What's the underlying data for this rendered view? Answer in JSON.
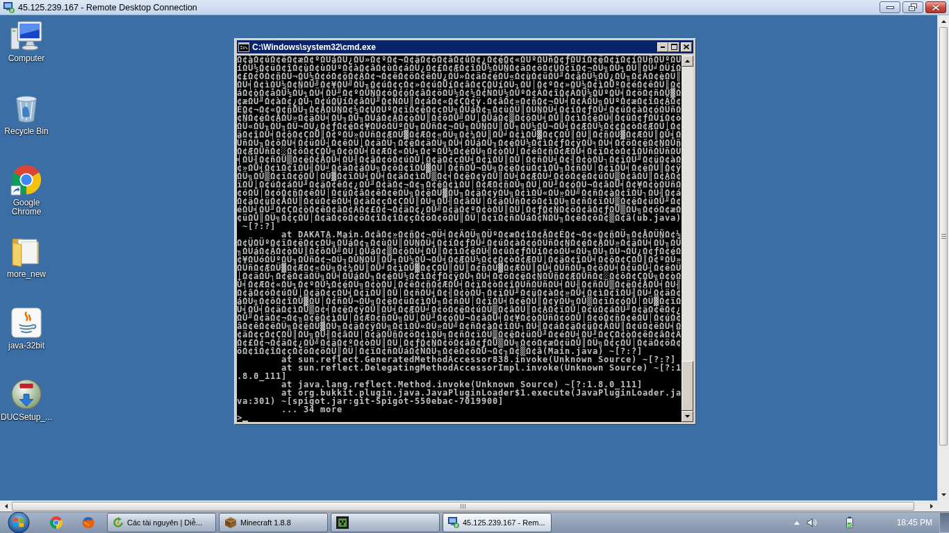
{
  "window": {
    "title": "45.125.239.167 - Remote Desktop Connection"
  },
  "desktop": {
    "icons": [
      {
        "label": "Computer"
      },
      {
        "label": "Recycle Bin"
      },
      {
        "label": "Google Chrome"
      },
      {
        "label": "more_new"
      },
      {
        "label": "java-32bit"
      },
      {
        "label": "DUCSetup_..."
      }
    ]
  },
  "console_window": {
    "title": "C:\\Windows\\system32\\cmd.exe",
    "lines": [
      {
        "kind": "output",
        "text": "Ω¢àΩ¢úΩ¢ëΩ¢æΩ¢ºΩÜáΩÜ¿ΩÜ»Ω¢ºΩ¢¬Ω¢äΩ¢öΩ¢åΩ¢ûΩ¢¿Ω¢éΩ¢«ΩÜºΩÜñΩ¢ƒΩÜíΩ¢ëΩ¢ïΩ¢íΩÜñΩÜºΩÜ"
      },
      {
        "kind": "output",
        "text": "íΩÜ½Ω¢üΩ¢îΩ¢ùΩ¢ùΩÜºΩ¢àΩ¢âΩ¢ùΩ¢áΩÜ¿Ω¢£Ω¢ÆΩ¢îΩÜ½ΩÜÑΩ¢äΩ¢öΩ¢ÜΩ¢ïΩ¢¬ΩÜ╗ΩÜ╕ΩÜ║ΩÜ╛ΩÜíΩ"
      },
      {
        "kind": "output",
        "text": "¢£Ω¢ÖΩ¢ñΩÜ¬ΩÜ½Ω¢óΩ¢öΩ¢ÄΩ¢¬Ω¢ëΩ¢öΩ¢ëΩÜ¿ΩÜ»Ω¢äΩ¢éΩÜ«Ω¢ùΩ¢üΩÜ╜Ω¢åΩÜ½ΩÜ¿ΩÜ╖Ω¢ÄΩ¢èΩÜ║"
      },
      {
        "kind": "output",
        "text": "ΩÜ╡Ω¢ìΩÜ½Ω¢ÑΩÜ╝Ω¢¥ΩÜ╝ΩÜ╖Ω¢úΩ¢çΩ¢»Ω¢úΩÜíΩ¢âΩ¢ÇΩÜíΩÜ┐ΩÜ│Ω¢ºΩ¢»ΩÜ½Ω¢ìΩÜºΩ¢éΩ¢êΩÜ║Ω¢"
      },
      {
        "kind": "output",
        "text": "áΩ¢òΩ¢åΩÜ½ΩÜ╕ΩÜ╡ΩÜ╜Ω¢ºΩÜÑΩ¢óΩ¢óΩ¢âΩ¢öΩÜ½Ω¢½Ω¢ÑΩÜ½ΩÜºΩ¢ÄΩ¢îΩ¢ÄΩÜ½ΩÜºΩÜ╡Ω¢öΩ¢ñΩÜ▓Ω"
      },
      {
        "kind": "output",
        "text": "¢æΩÜ╜Ω¢àΩ¢¿ΩÜ┐Ω¢úΩÜíΩ¢âΩÜ╜Ω¢ÑΩÜ║Ω¢áΩ¢«Ω¢ÇΩ¢ÿ.Ω¢âΩ¢»Ω¢ñΩ¢¬ΩÜ╡Ω¢ÄΩÜ╗ΩÜºΩ¢æΩ¢îΩ¢ÄΩ¢"
      },
      {
        "kind": "output",
        "text": "ÉΩ¢¬Ω¢«Ω¢ñΩÜ╖Ω¢ÅΩÜÑΩ¢½Ω¢ÜΩÜºΩ¢ïΩ¢ëΩ¢çΩÜ╗ΩÜáΩ¢╖Ω¢ùΩÜ║ΩÜÑΩÜ╡Ω¢íΩ¢ƒΩÜ╛Ω¢úΩ¢àΩ¢óΩÜñΩ"
      },
      {
        "kind": "output",
        "text": "¢ÑΩ¢éΩ¢ÅΩÜ»Ω¢äΩÜ╡ΩÜ╖ΩÜ╖ΩÜáΩ¢ÄΩ¢òΩÜ║Ω¢ôΩÜ╝ΩÜ│ΩÜáΩ¢▒Ω¢ôΩÜ╡ΩÜ║Ω¢ìΩ¢êΩÜ╣Ω¢ûΩ¢ƒΩÜíΩ¢ò"
      },
      {
        "kind": "output",
        "text": "ΩÜ«ΩÜ╖ΩÜ╖ΩÜ¬ΩÜ¿Ω¢ƒΩ¢éΩ¢¥ΩÜóΩÜºΩÜ╖ΩÜñΩ¢¬ΩÜ╖ΩÜÑΩÜ║ΩÜ╖ΩÜ½ΩÜ¬ΩÜ╡Ω¢ÆΩÜ½Ω¢¢Ω¢òΩ¢ÆΩÜ│Ω¢"
      },
      {
        "kind": "output",
        "text": "äΩ¢îΩÜ╡Ω¢ôΩ¢ÇΩÜ║Ω¢ºΩÜ»ΩÜñΩ¢ÆΩÜ▓Ω¢ÆΩ¢«ΩÜ╗Ω¢¼ΩÜ║ΩÜ╛Ω¢ìΩÜ▓Ω¢ÇΩÜ║ΩÜ║Ω¢ñΩÜ▓Ω¢ÆΩÜ║ΩÜ╡Ω"
      },
      {
        "kind": "output",
        "text": "ÜñΩÜ╖Ω¢ôΩÜ╡Ω¢üΩÜ┤Ω¢êΩÜ│Ω¢äΩÜ┐Ω¢ëΩ¢äΩÜ╗ΩÜ╡ΩÜáΩÜ╖Ω¢éΩÜ½Ω¢ìΩ¢ƒΩ¢ÿΩÜ╕ΩÜ╡Ω¢öΩ¢ëΩ¢ÑΩÜñ"
      },
      {
        "kind": "output",
        "text": "Ω¢ÆΩÜñΩ¢░Ω¢ôΩ¢ÇΩÜ╗Ω¢òΩÜ╡Ω¢ÆΩ¢«ΩÜ╕Ω¢ºΩÜ¼Ω¢éΩÜ╗Ω¢òΩÜ│Ω¢êΩ¢ñΩ¢ÆΩÜ╡Ω¢ïΩ¢òΩ¢îΩÜñΩÜñΩÜ"
      },
      {
        "kind": "output",
        "text": "╡ΩÜ╢Ω¢ñΩÜ▒Ω¢ëΩ¢ÅΩÜ╡ΩÜ╢Ω¢âΩ¢óΩ¢úΩÜ│Ω¢äΩ¢çΩÜ╡Ω¢ïΩÜ║ΩÜ│Ω¢ñΩÜ╡Ω¢╢Ω¢òΩÜ┐Ω¢ïΩÜ╜Ω¢üΩ¢àΩ"
      },
      {
        "kind": "output",
        "text": "¢»ΩÜ╡Ω¢ìΩ¢îΩÜ╢ΩÜ╛Ω¢äΩ¢áΩÜ╗Ω¢ôΩ¢îΩÜ▓ΩÜ│Ω¢ñΩÜ¬ΩÜ╗Ω¢ëΩ¢üΩ¢ìΩÜ╖Ω¢ñΩÜ│Ω¢ïΩÜ╡Ω¢ëΩÜ║Ω¢ÿ"
      },
      {
        "kind": "output",
        "text": "ΩÜ╗ΩÜ▒Ω¢ïΩ¢óΩÜ│ΩÜ▓Ω¢ïΩÜ╡ΩÜ╡Ω¢äΩ¢ìΩÜ▒Ω¢╡Ω¢ëΩ¢ÿΩÜ║ΩÜ╡Ω¢ÆΩÜ╛Ω¢óΩ¢ëΩ¢úΩÜ▒Ω¢âΩÜ║Ω¢ÄΩ¢"
      },
      {
        "kind": "output",
        "text": "ïΩÜ│Ω¢úΩ¢áΩÜ╜Ω¢äΩ¢êΩ¢¿ΩÜ╜Ω¢äΩ¢¬Ω¢╖Ω¢êΩ¢ìΩÜ│Ω¢ÆΩ¢ñΩÜ╗ΩÜ│ΩÜ╜Ω¢óΩÜ¬Ω¢âΩÜ╡Ω¢¥Ω¢òΩÜñΩ"
      },
      {
        "kind": "output",
        "text": "¢óΩÜ│Ω¢óΩ¢ñΩ¢êΩÜ│Ω¢úΩ¢âΩ¢êΩ¢ëΩÜ╗Ω¢ëΩÜ▓ΩÜ╖Ω¢äΩ¢ÿΩÜ╗Ω¢ìΩÜ«ΩÜ»ΩÜ╝Ω¢ñΩ¢àΩ¢îΩÜ┐ΩÜ╢Ω¢á"
      },
      {
        "kind": "output",
        "text": "Ω¢äΩ¢üΩ¢ÅΩÜ║Ω¢úΩ¢ëΩÜ╡Ω¢äΩ¢çΩ¢ÇΩÜ║ΩÜ╗ΩÜ╢Ω¢âΩÜ│Ω¢äΩÜñΩ¢öΩ¢ìΩÜ╗Ω¢ñΩ¢ïΩÜ▒Ω¢êΩ¢üΩÜ╜Ω¢"
      },
      {
        "kind": "output",
        "text": "éΩÜ╡ΩÜ╜Ω¢ÇΩ¢òΩ¢êΩ¢âΩ¢ÄΩ¢£Ω¢¬Ω¢äΩ¢¿ΩÜ╝Ω¢äΩ¢ºΩ¢òΩÜ║ΩÜ│Ω¢ƒΩ¢ÑΩ¢öΩ¢âΩ¢ƒΩÜ▒ΩÜ╗Ω¢óΩ¢æΩ"
      },
      {
        "kind": "output",
        "text": "¢üΩÜ║ΩÜ╗Ω¢çΩÜ│Ω¢äΩ¢öΩ¢öΩ¢îΩ¢îΩ¢çΩ¢öΩ¢öΩÜ║ΩÜ│Ω¢ïΩ¢ñΩÜáΩ¢ÑΩÜ╖Ω¢êΩ¢ôΩ¢▒Ω¢â(ub.java)"
      },
      {
        "kind": "output",
        "text": " ~[?:?]"
      },
      {
        "kind": "frame",
        "text": "at DAKATA.Main.Ω¢âΩ¢»Ω¢ñΩ¢¬ΩÜ╡Ω¢ÄΩÜ╗ΩÜºΩ¢æΩ¢îΩ¢ÄΩ¢ÉΩ¢¬Ω¢«Ω¢ñΩÜ╖Ω¢ÅΩÜÑΩ¢½"
      },
      {
        "kind": "output",
        "text": "Ω¢ÜΩÜºΩ¢ïΩ¢ëΩ¢çΩÜ╗ΩÜáΩ¢╖Ω¢ùΩÜ║ΩÜÑΩÜ╡Ω¢íΩ¢ƒΩÜ╛Ω¢úΩ¢àΩ¢óΩÜñΩ¢ÑΩ¢éΩ¢ÅΩÜ»Ω¢äΩÜ╡ΩÜ╖ΩÜ"
      },
      {
        "kind": "output",
        "text": "╖ΩÜáΩ¢ÄΩ¢òΩÜ║Ω¢ôΩÜ╝ΩÜ│ΩÜáΩ¢▒Ω¢ôΩÜ╡ΩÜ║Ω¢ìΩ¢êΩÜ╣Ω¢ûΩ¢ƒΩÜíΩ¢òΩÜ«ΩÜ╖ΩÜ╖ΩÜ¬ΩÜ¿Ω¢ƒΩ¢éΩ"
      },
      {
        "kind": "output",
        "text": "¢¥ΩÜóΩÜºΩÜ╖ΩÜñΩ¢¬ΩÜ╖ΩÜÑΩÜ║ΩÜ╖ΩÜ½ΩÜ¬ΩÜ╡Ω¢ÆΩÜ½Ω¢¢Ω¢òΩ¢ÆΩÜ│Ω¢äΩ¢îΩÜ╡Ω¢ôΩ¢ÇΩÜ║Ω¢ºΩÜ»"
      },
      {
        "kind": "output",
        "text": "ΩÜñΩ¢ÆΩÜ▓Ω¢ÆΩ¢«ΩÜ╗Ω¢¼ΩÜ║ΩÜ╛Ω¢ìΩÜ▓Ω¢ÇΩÜ║ΩÜ║Ω¢ñΩÜ▓Ω¢ÆΩÜ║ΩÜ╡ΩÜñΩÜ╖Ω¢ôΩÜ╡Ω¢üΩÜ┤Ω¢êΩÜ"
      },
      {
        "kind": "output",
        "text": "│Ω¢äΩÜ┐Ω¢ëΩ¢äΩÜ╗ΩÜ╡ΩÜáΩÜ╖Ω¢éΩÜ½Ω¢ìΩ¢ƒΩ¢ÿΩÜ╕ΩÜ╡Ω¢öΩ¢ëΩ¢ÑΩÜñΩ¢ÆΩÜñΩ¢░Ω¢ôΩ¢ÇΩÜ╗Ω¢òΩ"
      },
      {
        "kind": "output",
        "text": "Ü╡Ω¢ÆΩ¢«ΩÜ╕Ω¢ºΩÜ¼Ω¢éΩÜ╗Ω¢òΩÜ│Ω¢êΩ¢ñΩ¢ÆΩÜ╡Ω¢ïΩ¢òΩ¢îΩÜñΩÜñΩÜ╡ΩÜ╢Ω¢ñΩÜ▒Ω¢ëΩ¢ÅΩÜ╡ΩÜ╢"
      },
      {
        "kind": "output",
        "text": "Ω¢âΩ¢óΩ¢úΩÜ│Ω¢äΩ¢çΩÜ╡Ω¢ïΩÜ║ΩÜ│Ω¢ñΩÜ╡Ω¢╢Ω¢òΩÜ┐Ω¢ïΩÜ╜Ω¢üΩ¢àΩ¢»ΩÜ╡Ω¢ìΩ¢îΩÜ╢ΩÜ╛Ω¢äΩ¢"
      },
      {
        "kind": "output",
        "text": "áΩÜ╗Ω¢ôΩ¢îΩÜ▓ΩÜ│Ω¢ñΩÜ¬ΩÜ╗Ω¢ëΩ¢üΩ¢ìΩÜ╖Ω¢ñΩÜ│Ω¢ïΩÜ╡Ω¢ëΩÜ║Ω¢ÿΩÜ╗ΩÜ▒Ω¢ïΩ¢óΩÜ│ΩÜ▓Ω¢ïΩ"
      },
      {
        "kind": "output",
        "text": "Ü╡ΩÜ╡Ω¢äΩ¢ìΩÜ▒Ω¢╡Ω¢ëΩ¢ÿΩÜ║ΩÜ╡Ω¢ÆΩÜ╛Ω¢óΩ¢ëΩ¢úΩÜ▒Ω¢âΩÜ║Ω¢ÄΩ¢ïΩÜ│Ω¢úΩ¢áΩÜ╜Ω¢äΩ¢êΩ¢¿"
      },
      {
        "kind": "output",
        "text": "ΩÜ╜Ω¢äΩ¢¬Ω¢╖Ω¢êΩ¢ìΩÜ│Ω¢ÆΩ¢ñΩÜ╗ΩÜ│ΩÜ╜Ω¢óΩÜ¬Ω¢âΩÜ╡Ω¢¥Ω¢òΩÜñΩ¢óΩÜ│Ω¢óΩ¢ñΩ¢êΩÜ│Ω¢úΩ¢"
      },
      {
        "kind": "output",
        "text": "âΩ¢êΩ¢ëΩÜ╗Ω¢ëΩÜ▓ΩÜ╖Ω¢äΩ¢ÿΩÜ╗Ω¢ìΩÜ«ΩÜ»ΩÜ╝Ω¢ñΩ¢àΩ¢îΩÜ┐ΩÜ╢Ω¢áΩ¢äΩ¢üΩ¢ÅΩÜ║Ω¢úΩ¢ëΩÜ╡Ω"
      },
      {
        "kind": "output",
        "text": "¢äΩ¢çΩ¢ÇΩÜ║ΩÜ╗ΩÜ╢Ω¢âΩÜ│Ω¢äΩÜñΩ¢öΩ¢ìΩÜ╗Ω¢ñΩ¢ïΩÜ▒Ω¢êΩ¢üΩÜ╜Ω¢éΩÜ╡ΩÜ╜Ω¢ÇΩ¢òΩ¢êΩ¢âΩ¢Ä"
      },
      {
        "kind": "output",
        "text": "Ω¢£Ω¢¬Ω¢äΩ¢¿ΩÜ╝Ω¢äΩ¢ºΩ¢òΩÜ║ΩÜ│Ω¢ƒΩ¢ÑΩ¢öΩ¢âΩ¢ƒΩÜ▒ΩÜ╗Ω¢óΩ¢æΩ¢üΩÜ║ΩÜ╗Ω¢çΩÜ│Ω¢äΩ¢öΩ¢"
      },
      {
        "kind": "output",
        "text": "öΩ¢îΩ¢îΩ¢çΩ¢öΩ¢öΩÜ║ΩÜ│Ω¢ïΩ¢ñΩÜáΩ¢ÑΩÜ╖Ω¢êΩ¢ôΩÜ¬Ω¢╖Ω¢▒Ω¢â(Main.java) ~[?:?]"
      },
      {
        "kind": "frame",
        "text": "at sun.reflect.GeneratedMethodAccessor838.invoke(Unknown Source) ~[?:?]"
      },
      {
        "kind": "frame",
        "text": "at sun.reflect.DelegatingMethodAccessorImpl.invoke(Unknown Source) ~[?:1"
      },
      {
        "kind": "output",
        "text": ".8.0_111]"
      },
      {
        "kind": "frame",
        "text": "at java.lang.reflect.Method.invoke(Unknown Source) ~[?:1.8.0_111]"
      },
      {
        "kind": "frame",
        "text": "at org.bukkit.plugin.java.JavaPluginLoader$1.execute(JavaPluginLoader.ja"
      },
      {
        "kind": "output",
        "text": "va:301) ~[spigot.jar:git-Spigot-550ebac-7019900]"
      },
      {
        "kind": "frame",
        "text": "... 34 more"
      },
      {
        "kind": "prompt",
        "text": ">"
      }
    ]
  },
  "taskbar": {
    "tasks": [
      {
        "label": "Các tài nguyên | Diễ...",
        "selected": false
      },
      {
        "label": "Minecraft 1.8.8",
        "selected": false
      },
      {
        "selected": false
      },
      {
        "label": "45.125.239.167 - Rem...",
        "selected": true
      }
    ],
    "clock": "18:45 PM"
  }
}
